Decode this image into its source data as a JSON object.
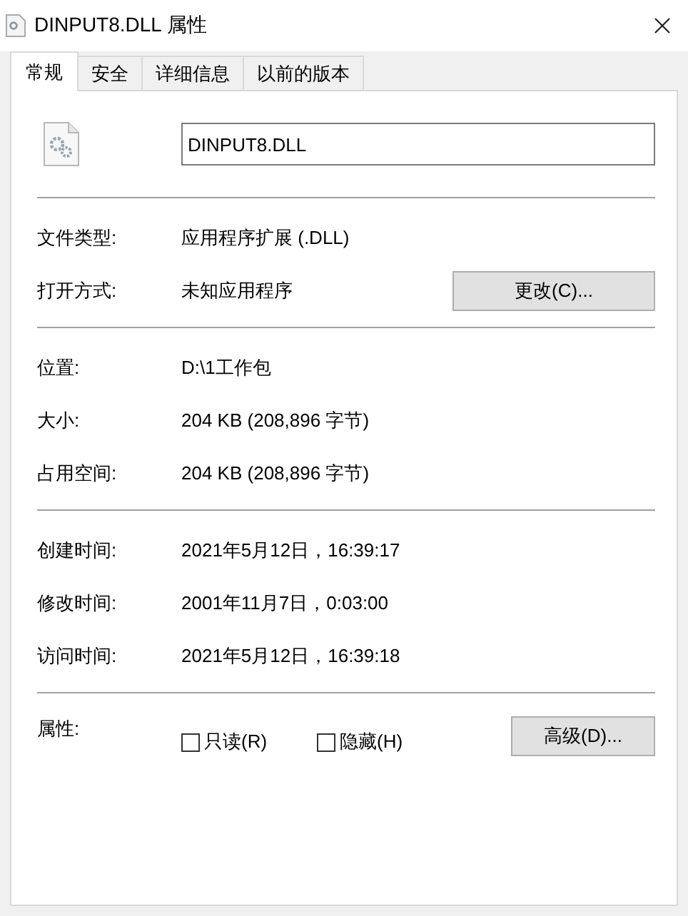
{
  "window": {
    "title": "DINPUT8.DLL 属性"
  },
  "tabs": [
    {
      "label": "常规",
      "selected": true
    },
    {
      "label": "安全",
      "selected": false
    },
    {
      "label": "详细信息",
      "selected": false
    },
    {
      "label": "以前的版本",
      "selected": false
    }
  ],
  "file_name": "DINPUT8.DLL",
  "sections": [
    [
      {
        "label": "文件类型:",
        "value": "应用程序扩展 (.DLL)"
      },
      {
        "label": "打开方式:",
        "value": "未知应用程序",
        "button": "更改(C)..."
      }
    ],
    [
      {
        "label": "位置:",
        "value": "D:\\1工作包"
      },
      {
        "label": "大小:",
        "value": "204 KB (208,896 字节)"
      },
      {
        "label": "占用空间:",
        "value": "204 KB (208,896 字节)"
      }
    ],
    [
      {
        "label": "创建时间:",
        "value": "2021年5月12日，16:39:17"
      },
      {
        "label": "修改时间:",
        "value": "2001年11月7日，0:03:00"
      },
      {
        "label": "访问时间:",
        "value": "2021年5月12日，16:39:18"
      }
    ]
  ],
  "attributes": {
    "label": "属性:",
    "checkboxes": [
      {
        "label": "只读(R)",
        "checked": false
      },
      {
        "label": "隐藏(H)",
        "checked": false
      }
    ],
    "button": "高级(D)..."
  }
}
